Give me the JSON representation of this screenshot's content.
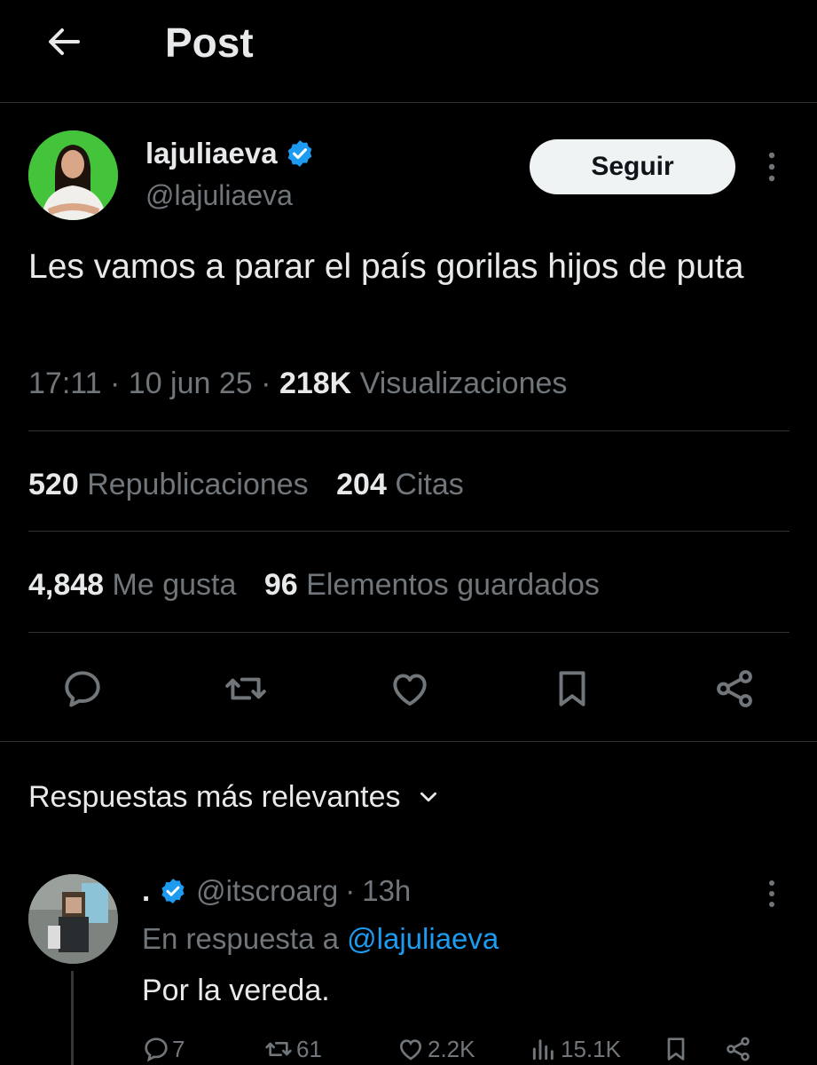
{
  "header": {
    "title": "Post"
  },
  "author": {
    "display_name": "lajuliaeva",
    "handle": "@lajuliaeva",
    "verified": true,
    "follow_label": "Seguir"
  },
  "post": {
    "text": "Les vamos a parar el país gorilas hijos de puta",
    "time": "17:11",
    "date": "10 jun 25",
    "views_count": "218K",
    "views_label": "Visualizaciones"
  },
  "stats": {
    "reposts_count": "520",
    "reposts_label": "Republicaciones",
    "quotes_count": "204",
    "quotes_label": "Citas",
    "likes_count": "4,848",
    "likes_label": "Me gusta",
    "bookmarks_count": "96",
    "bookmarks_label": "Elementos guardados"
  },
  "replies_section": {
    "sort_label": "Respuestas más relevantes"
  },
  "reply": {
    "display_name": ".",
    "handle": "@itscroarg",
    "age": "13h",
    "in_reply_prefix": "En respuesta a",
    "in_reply_handle": "@lajuliaeva",
    "text": "Por la vereda.",
    "reply_count": "7",
    "repost_count": "61",
    "like_count": "2.2K",
    "view_count": "15.1K"
  },
  "colors": {
    "background": "#000000",
    "text": "#e7e9ea",
    "muted": "#71767b",
    "accent": "#1d9bf0",
    "divider": "#2f3336"
  },
  "icons": [
    "back-arrow-icon",
    "verified-badge-icon",
    "more-vertical-icon",
    "reply-icon",
    "repost-icon",
    "like-icon",
    "bookmark-icon",
    "share-icon",
    "chevron-down-icon",
    "views-icon"
  ]
}
